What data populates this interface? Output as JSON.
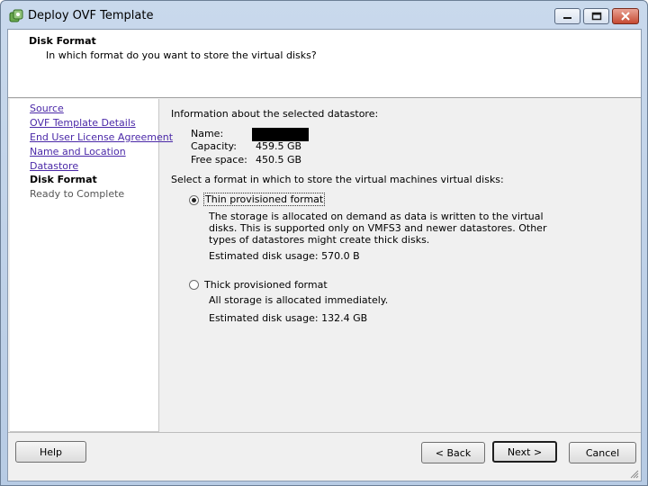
{
  "window": {
    "title": "Deploy OVF Template"
  },
  "header": {
    "title": "Disk Format",
    "subtitle": "In which format do you want to store the virtual disks?"
  },
  "nav": {
    "items": [
      {
        "label": "Source",
        "state": "link"
      },
      {
        "label": "OVF Template Details",
        "state": "link"
      },
      {
        "label": "End User License Agreement",
        "state": "link"
      },
      {
        "label": "Name and Location",
        "state": "link"
      },
      {
        "label": "Datastore",
        "state": "link"
      },
      {
        "label": "Disk Format",
        "state": "current"
      },
      {
        "label": "Ready to Complete",
        "state": "pending"
      }
    ]
  },
  "datastore": {
    "heading": "Information about the selected datastore:",
    "name_label": "Name:",
    "capacity_label": "Capacity:",
    "capacity_value": "459.5 GB",
    "free_label": "Free space:",
    "free_value": "450.5 GB"
  },
  "format": {
    "prompt": "Select a format in which to store the virtual machines virtual disks:",
    "options": [
      {
        "label": "Thin provisioned format",
        "selected": true,
        "description": "The storage is allocated on demand as data is written to the virtual disks. This is supported only on VMFS3 and newer datastores. Other types of datastores might create thick disks.",
        "usage": "Estimated disk usage: 570.0 B"
      },
      {
        "label": "Thick provisioned format",
        "selected": false,
        "description": "All storage is allocated immediately.",
        "usage": "Estimated disk usage: 132.4 GB"
      }
    ]
  },
  "buttons": {
    "help": "Help",
    "back": "< Back",
    "next": "Next >",
    "cancel": "Cancel"
  },
  "colors": {
    "link": "#4b29a8",
    "close_button": "#c64a32"
  }
}
